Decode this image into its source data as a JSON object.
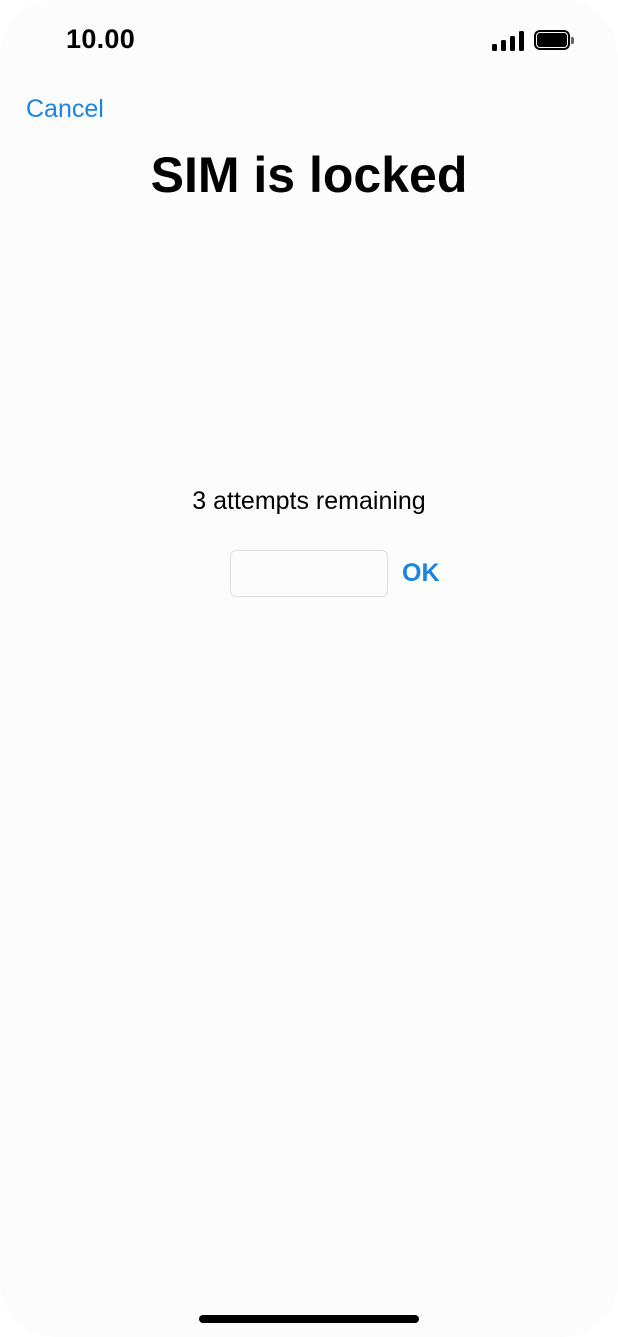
{
  "status_bar": {
    "time": "10.00",
    "signal_icon": "cellular-signal-icon",
    "signal_bars": 4,
    "battery_icon": "battery-full-icon",
    "battery_level": 1.0
  },
  "nav": {
    "cancel_label": "Cancel"
  },
  "page": {
    "title": "SIM is locked",
    "attempts_text": "3 attempts remaining"
  },
  "pin_entry": {
    "value": "",
    "placeholder": ""
  },
  "actions": {
    "ok_label": "OK"
  },
  "colors": {
    "accent": "#1a84e0",
    "background": "#fcfcfc",
    "text": "#000000"
  }
}
